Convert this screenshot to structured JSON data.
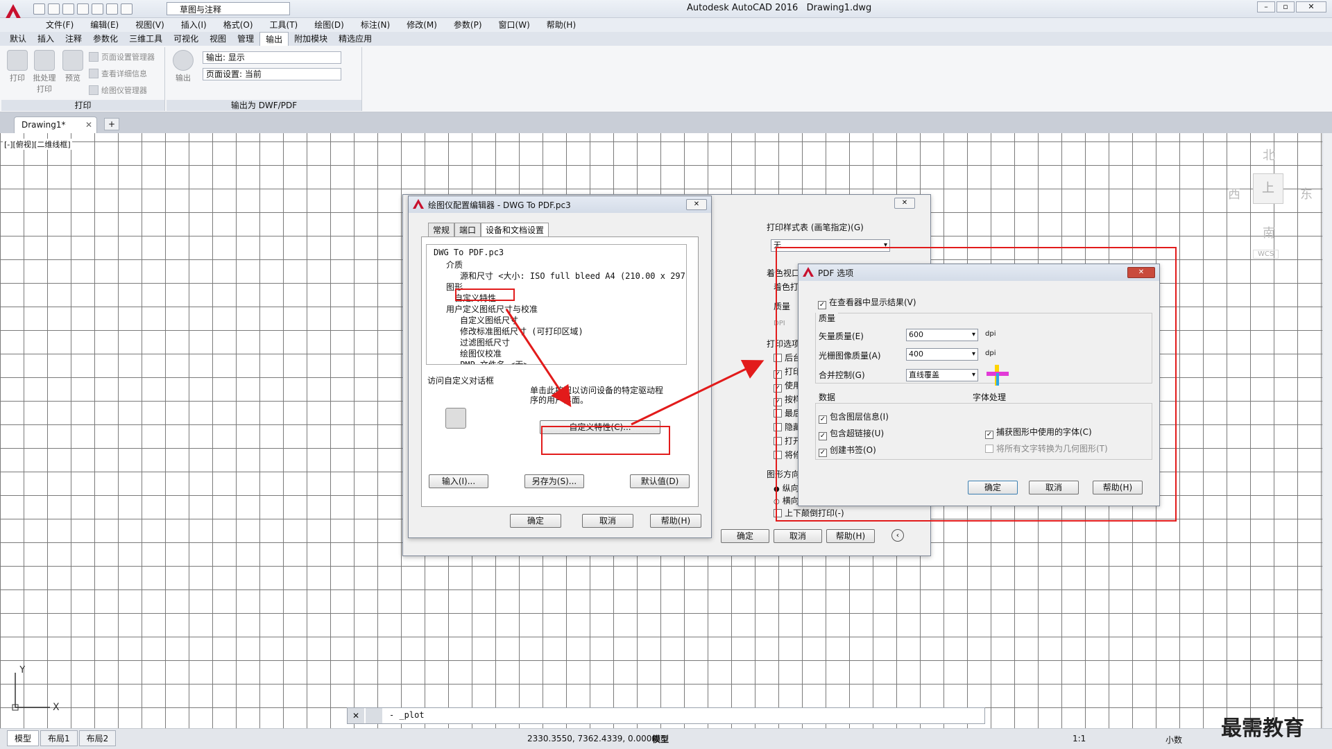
{
  "app": {
    "title": "Autodesk AutoCAD 2016",
    "file": "Drawing1.dwg",
    "workspace": "草图与注释",
    "menu": [
      "文件(F)",
      "编辑(E)",
      "视图(V)",
      "插入(I)",
      "格式(O)",
      "工具(T)",
      "绘图(D)",
      "标注(N)",
      "修改(M)",
      "参数(P)",
      "窗口(W)",
      "帮助(H)"
    ],
    "ribbon_tabs": [
      "默认",
      "插入",
      "注释",
      "参数化",
      "三维工具",
      "可视化",
      "视图",
      "管理",
      "输出",
      "附加模块",
      "精选应用"
    ],
    "active_ribbon_tab": "输出"
  },
  "ribbon": {
    "print_panel": {
      "label": "打印",
      "plot": "打印",
      "batch": "批处理\n打印",
      "preview": "预览",
      "page_setup_mgr": "页面设置管理器",
      "view_details": "查看详细信息",
      "plotter_mgr": "绘图仪管理器"
    },
    "export_panel": {
      "label": "输出为 DWF/PDF",
      "export": "输出",
      "output_field": "输出: 显示",
      "page_setup_field": "页面设置: 当前"
    }
  },
  "doc_tab": "Drawing1*",
  "view_label": "[-][俯视][二维线框]",
  "viewcube": {
    "north": "北",
    "south": "南",
    "east": "东",
    "west": "西",
    "top": "上",
    "wcs": "WCS"
  },
  "plotter_dialog": {
    "title": "绘图仪配置编辑器 - DWG To PDF.pc3",
    "tabs": [
      "常规",
      "端口",
      "设备和文档设置"
    ],
    "tree": [
      "DWG To PDF.pc3",
      "介质",
      "源和尺寸 <大小: ISO full bleed A4 (210.00 x 297.0",
      "图形",
      "自定义特性",
      "用户定义图纸尺寸与校准",
      "自定义图纸尺寸",
      "修改标准图纸尺寸 (可打印区域)",
      "过滤图纸尺寸",
      "绘图仪校准",
      "PMP 文件名 <无>"
    ],
    "group_label": "访问自定义对话框",
    "desc": "单击此按钮以访问设备的特定驱动程序的用户界面。",
    "custom_btn": "自定义特性(C)...",
    "import_btn": "输入(I)...",
    "saveas_btn": "另存为(S)...",
    "default_btn": "默认值(D)",
    "ok": "确定",
    "cancel": "取消",
    "help": "帮助(H)"
  },
  "plot_dialog_bg": {
    "style_table_label": "打印样式表 (画笔指定)(G)",
    "style_table_value": "无",
    "shaded_label": "着色视口",
    "shaded_print": "着色打",
    "quality": "质量",
    "dpi": "DPI",
    "options_label": "打印选项",
    "opt_items": [
      "后台",
      "打印",
      "使用",
      "按样",
      "最后",
      "隐藏",
      "打开",
      "将修"
    ],
    "orientation_label": "图形方向",
    "orient_items": [
      "纵向",
      "横向"
    ],
    "upside_down": "上下颠倒打印(-)",
    "ok": "确定",
    "cancel": "取消",
    "help": "帮助(H)"
  },
  "pdf_dialog": {
    "title": "PDF 选项",
    "show_in_viewer": "在查看器中显示结果(V)",
    "quality_label": "质量",
    "vector_label": "矢量质量(E)",
    "vector_value": "600",
    "raster_label": "光栅图像质量(A)",
    "raster_value": "400",
    "merge_label": "合并控制(G)",
    "merge_value": "直线覆盖",
    "dpi": "dpi",
    "data_label": "数据",
    "include_layers": "包含图层信息(I)",
    "include_links": "包含超链接(U)",
    "create_bookmarks": "创建书签(O)",
    "font_label": "字体处理",
    "capture_fonts": "捕获图形中使用的字体(C)",
    "convert_text": "将所有文字转换为几何图形(T)",
    "ok": "确定",
    "cancel": "取消",
    "help": "帮助(H)"
  },
  "command": {
    "prompt": "- _plot"
  },
  "status": {
    "coords": "2330.3550, 7362.4339, 0.0000",
    "model": "模型",
    "scale": "1:1",
    "units": "小数",
    "layout_tabs": [
      "模型",
      "布局1",
      "布局2"
    ]
  },
  "watermark": "最需教育",
  "colors": {
    "accent_red": "#e21b1b",
    "autocad_red": "#c8102e"
  }
}
